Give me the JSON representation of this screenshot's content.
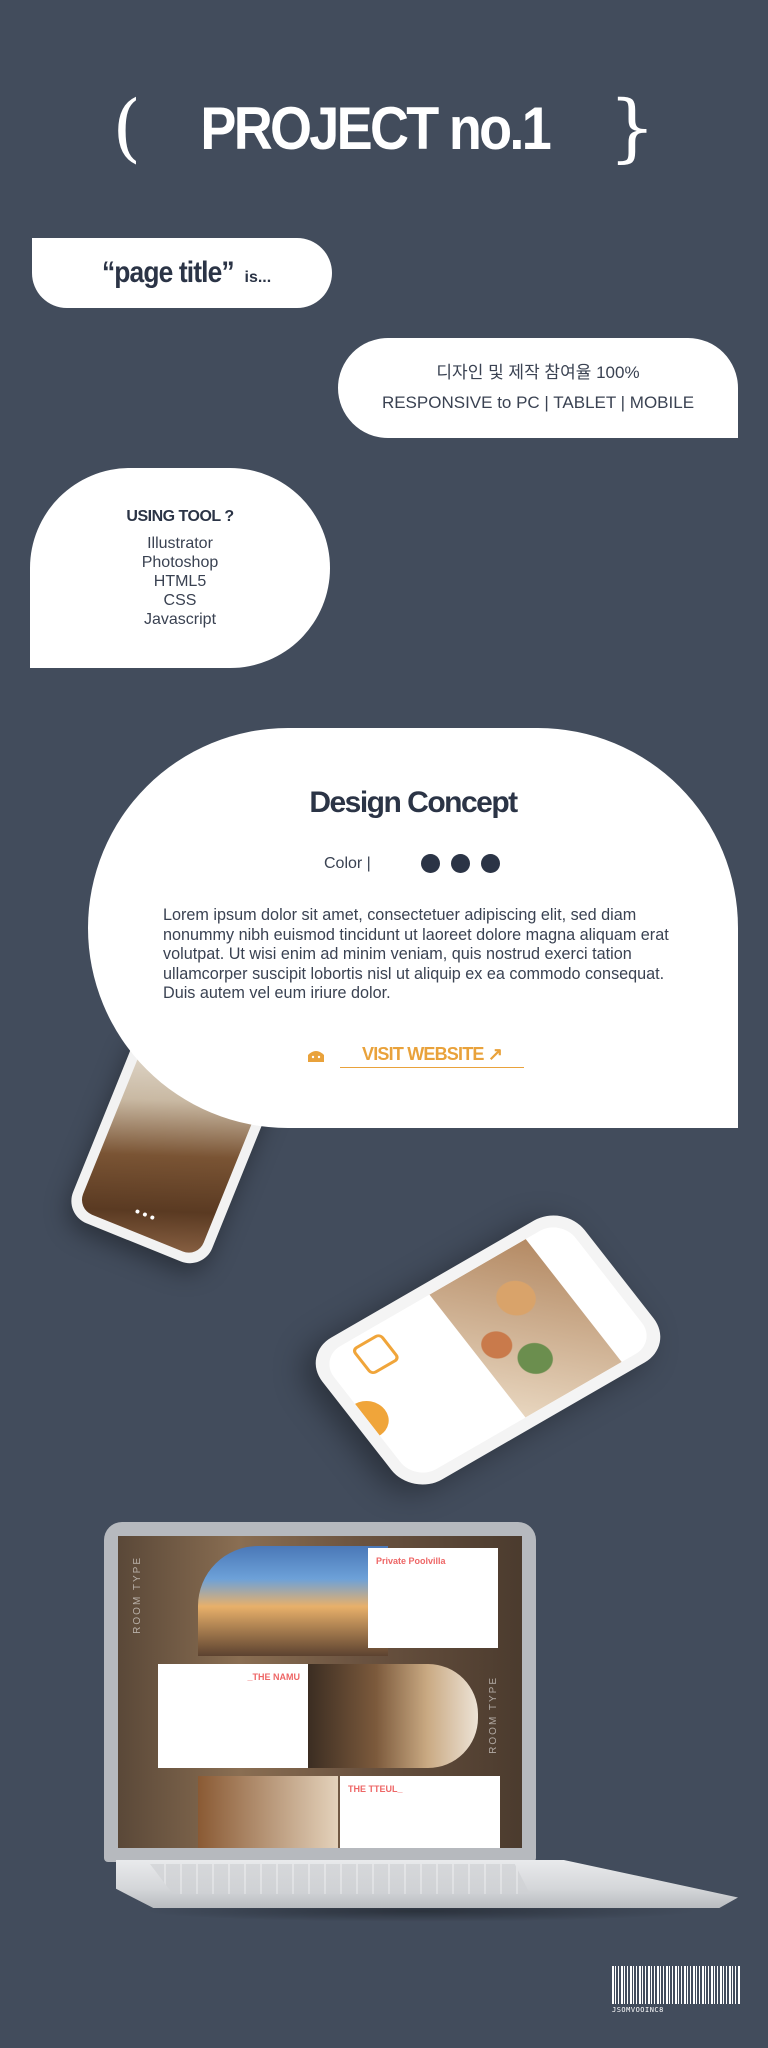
{
  "header": {
    "open_brace": "(",
    "title": "PROJECT no.1",
    "close_brace": "}"
  },
  "page_title_pill": {
    "title": "“page title”",
    "suffix": "is..."
  },
  "spec_pill": {
    "line1": "디자인 및 제작 참여율 100%",
    "line2": "RESPONSIVE to PC | TABLET | MOBILE"
  },
  "tools": {
    "heading": "USING TOOL ?",
    "items": [
      "Illustrator",
      "Photoshop",
      "HTML5",
      "CSS",
      "Javascript"
    ]
  },
  "concept": {
    "title": "Design Concept",
    "color_label": "Color |",
    "colors": [
      "#2b3446",
      "#2b3446",
      "#2b3446"
    ],
    "body": "Lorem ipsum dolor sit amet, consectetuer adipiscing elit, sed diam nonummy nibh euismod tincidunt ut laoreet dolore magna aliquam erat volutpat. Ut wisi enim ad minim veniam, quis nostrud exerci tation ullamcorper suscipit lobortis nisl ut aliquip ex ea commodo consequat. Duis autem vel eum iriure dolor.",
    "visit_label": "VISIT WEBSITE ↗",
    "accent": "#e9a23b"
  },
  "laptop_site": {
    "card1_title": "Private Poolvilla",
    "card2_title": "_THE NAMU",
    "card3_title": "THE TTEUL_",
    "vertical_label": "ROOM TYPE"
  },
  "barcode": {
    "number": "JSOMVOOINC8"
  }
}
